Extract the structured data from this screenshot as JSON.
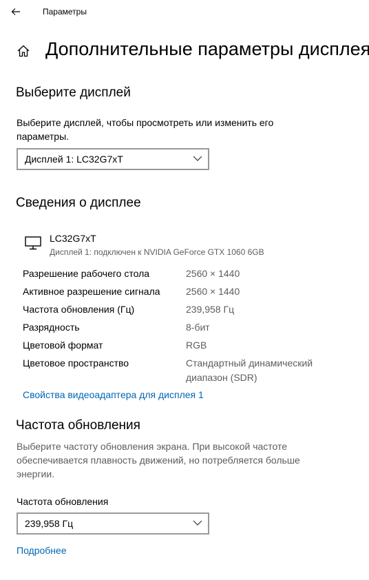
{
  "titlebar": {
    "app_title": "Параметры"
  },
  "header": {
    "title": "Дополнительные параметры дисплея"
  },
  "choose_display": {
    "heading": "Выберите дисплей",
    "description_line1": "Выберите дисплей, чтобы просмотреть или изменить его",
    "description_line2": "параметры.",
    "selected": "Дисплей 1: LC32G7xT"
  },
  "display_info": {
    "heading": "Сведения о дисплее",
    "monitor_name": "LC32G7xT",
    "monitor_sub": "Дисплей 1: подключен к NVIDIA GeForce GTX 1060 6GB",
    "rows": [
      {
        "label": "Разрешение рабочего стола",
        "value": "2560 × 1440"
      },
      {
        "label": "Активное разрешение сигнала",
        "value": "2560 × 1440"
      },
      {
        "label": "Частота обновления (Гц)",
        "value": "239,958 Гц"
      },
      {
        "label": "Разрядность",
        "value": "8-бит"
      },
      {
        "label": "Цветовой формат",
        "value": "RGB"
      },
      {
        "label": "Цветовое пространство",
        "value_line1": "Стандартный динамический",
        "value_line2": "диапазон (SDR)"
      }
    ],
    "adapter_link": "Свойства видеоадаптера для дисплея 1"
  },
  "refresh": {
    "heading": "Частота обновления",
    "description_line1": "Выберите частоту обновления экрана. При высокой частоте",
    "description_line2": "обеспечивается плавность движений, но потребляется больше",
    "description_line3": "энергии.",
    "field_label": "Частота обновления",
    "selected": "239,958 Гц",
    "more_link": "Подробнее"
  },
  "colors": {
    "link": "#0066b4",
    "secondary_text": "#5d5d5d",
    "border": "#999999"
  },
  "icons": [
    "back-arrow-icon",
    "home-icon",
    "monitor-icon",
    "chevron-down-icon"
  ]
}
